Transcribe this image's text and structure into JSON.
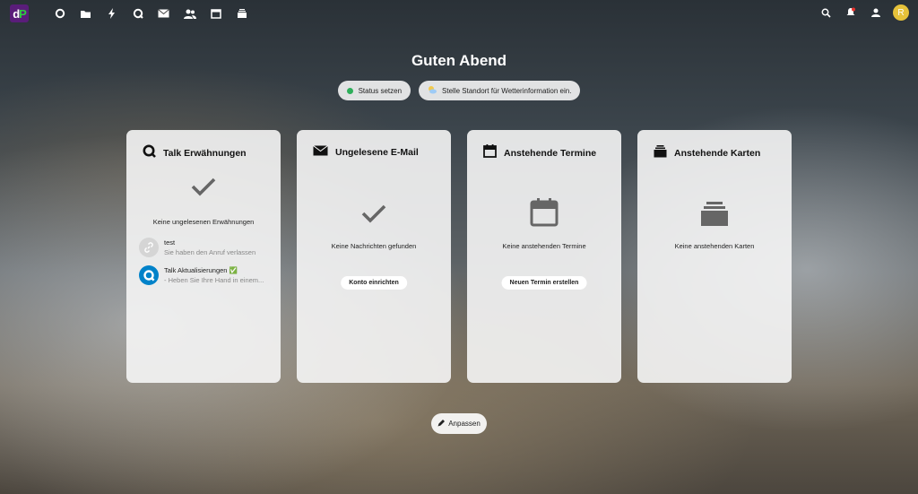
{
  "greeting": "Guten Abend",
  "status_pill": {
    "label": "Status setzen"
  },
  "weather_pill": {
    "label": "Stelle Standort für Wetterinformation ein."
  },
  "cards": {
    "talk": {
      "title": "Talk Erwähnungen",
      "empty": "Keine ungelesenen Erwähnungen",
      "items": [
        {
          "name": "test",
          "subtitle": "Sie haben den Anruf verlassen"
        },
        {
          "name": "Talk Aktualisierungen ✅",
          "subtitle": "- Heben Sie Ihre Hand in einem..."
        }
      ]
    },
    "mail": {
      "title": "Ungelesene E-Mail",
      "empty": "Keine Nachrichten gefunden",
      "button": "Konto einrichten"
    },
    "calendar": {
      "title": "Anstehende Termine",
      "empty": "Keine anstehenden Termine",
      "button": "Neuen Termin erstellen"
    },
    "deck": {
      "title": "Anstehende Karten",
      "empty": "Keine anstehenden Karten"
    }
  },
  "customize": {
    "label": "Anpassen"
  },
  "user": {
    "initial": "R"
  },
  "colors": {
    "status_online": "#2eae5a",
    "avatar": "#e6c23a",
    "talk_blue": "#0082c9"
  }
}
